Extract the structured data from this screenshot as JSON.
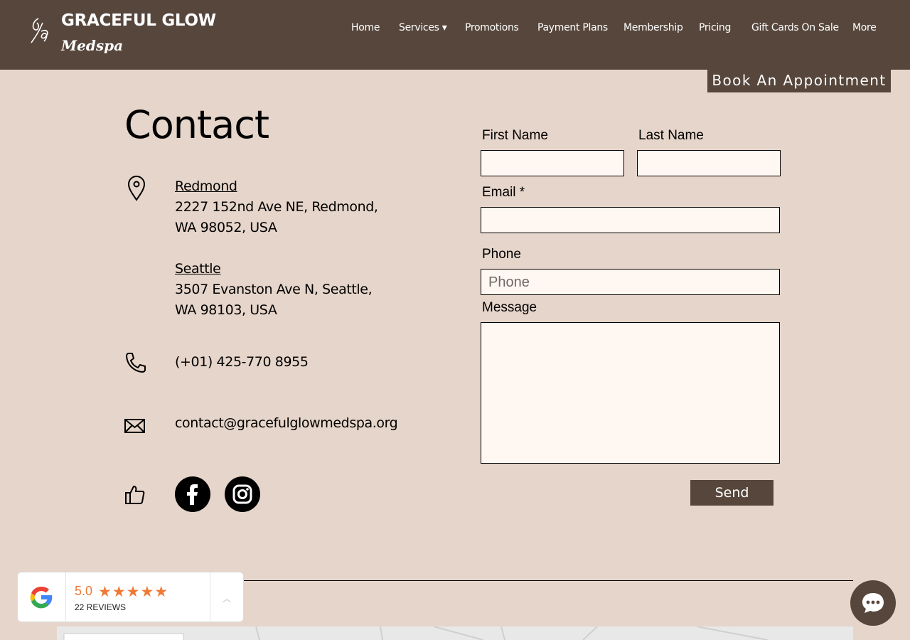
{
  "brand": {
    "name": "GRACEFUL GLOW",
    "sub": "Medspa"
  },
  "nav": {
    "items": [
      {
        "label": "Home"
      },
      {
        "label": "Services ▾"
      },
      {
        "label": "Promotions"
      },
      {
        "label": "Payment Plans"
      },
      {
        "label": "Membership"
      },
      {
        "label": "Pricing"
      },
      {
        "label": "Gift Cards On Sale"
      },
      {
        "label": "More"
      }
    ]
  },
  "cta": {
    "book": "Book An Appointment"
  },
  "contact": {
    "title": "Contact",
    "locations": [
      {
        "name": "Redmond",
        "line1": "2227 152nd Ave NE, Redmond,",
        "line2": "WA 98052, USA"
      },
      {
        "name": "Seattle",
        "line1": "3507 Evanston Ave N, Seattle,",
        "line2": "WA 98103, USA"
      }
    ],
    "phone": "(+01) 425-770 8955",
    "email": "contact@gracefulglowmedspa.org"
  },
  "form": {
    "first_name_label": "First Name",
    "last_name_label": "Last Name",
    "email_label": "Email *",
    "phone_label": "Phone",
    "phone_placeholder": "Phone",
    "message_label": "Message",
    "send_label": "Send"
  },
  "reviews": {
    "rating": "5.0",
    "count_label": "22 REVIEWS",
    "stars": "★★★★★"
  },
  "colors": {
    "header": "#56463c",
    "background": "#e6d5ca",
    "field": "#fff7f1",
    "star": "#ef7a35"
  }
}
